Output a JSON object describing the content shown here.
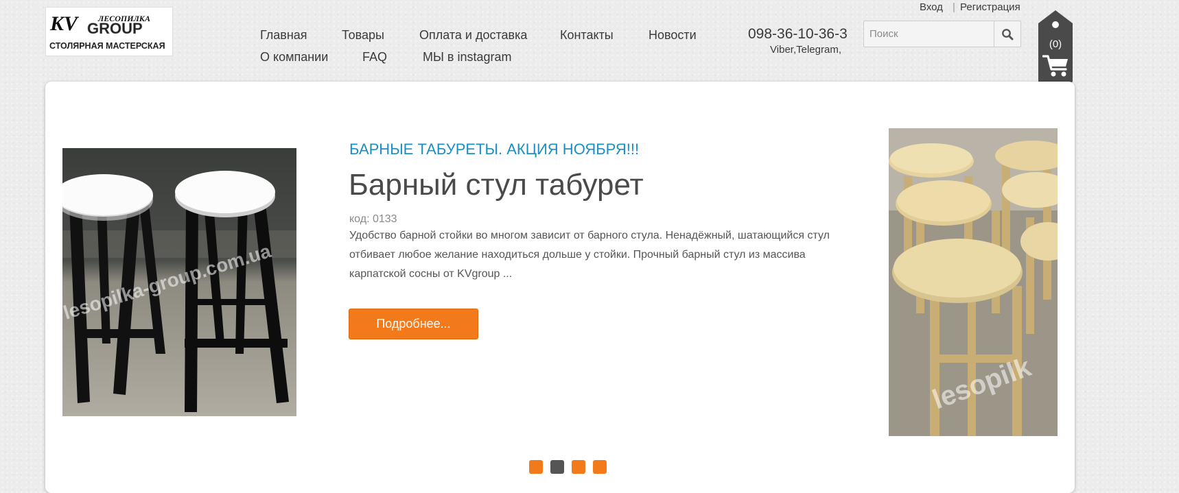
{
  "header": {
    "logo": {
      "alt": "KV Лесопилка Group — столярная мастерская",
      "text_kv": "KV",
      "text_top": "ЛЕСОПИЛКА",
      "text_group": "GROUP",
      "text_bottom": "СТОЛЯРНАЯ МАСТЕРСКАЯ"
    },
    "nav": [
      {
        "label": "Главная"
      },
      {
        "label": "Товары"
      },
      {
        "label": "Оплата и доставка"
      },
      {
        "label": "Контакты"
      },
      {
        "label": "Новости"
      },
      {
        "label": "О компании"
      },
      {
        "label": "FAQ"
      },
      {
        "label": "МЫ в instagram"
      }
    ],
    "phone": "098-36-10-36-3",
    "phone_note": "Viber,Telegram,",
    "auth": {
      "login": "Вход",
      "separator": "|",
      "register": "Регистрация"
    },
    "search": {
      "placeholder": "Поиск",
      "value": "",
      "icon": "search-icon"
    },
    "cart": {
      "count": "(0)",
      "icon": "cart-icon"
    }
  },
  "slide": {
    "subtitle": "БАРНЫЕ ТАБУРЕТЫ. АКЦИЯ НОЯБРЯ!!!",
    "title": "Барный стул табурет",
    "code": "код: 0133",
    "description": "Удобство барной стойки во многом зависит от барного стула. Ненадёжный, шатающийся стул отбивает любое желание находиться дольше у стойки. Прочный барный стул из массива карпатской сосны от KVgroup ...",
    "button": "Подробнее...",
    "left_image": {
      "alt": "Черные барные табуреты с белыми сиденьями",
      "watermark": "lesopilka-group.com.ua"
    },
    "right_image": {
      "alt": "Табуреты из сосны",
      "watermark": "lesopilk"
    }
  },
  "pagination": {
    "total": 4,
    "active_index": 1,
    "colors": {
      "active": "#555555",
      "inactive": "#f27a1a"
    }
  },
  "colors": {
    "accent": "#f27a1a",
    "link_blue": "#1a8fc5",
    "text_dark": "#3a3a3a"
  }
}
